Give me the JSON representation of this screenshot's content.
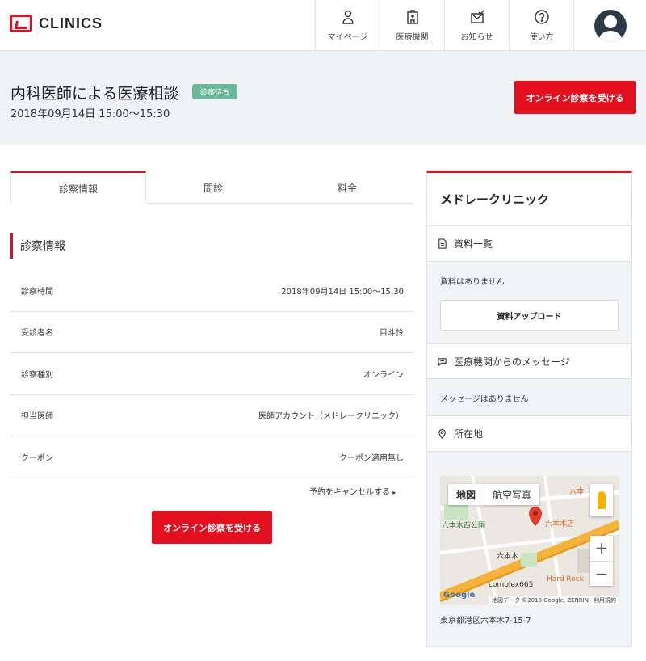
{
  "brand": {
    "name": "CLINICS"
  },
  "nav": {
    "items": [
      {
        "label": "マイページ",
        "icon": "mypage-icon"
      },
      {
        "label": "医療機関",
        "icon": "hospital-icon"
      },
      {
        "label": "お知らせ",
        "icon": "notice-icon"
      },
      {
        "label": "使い方",
        "icon": "help-icon"
      }
    ]
  },
  "header": {
    "title": "内科医師による医療相談",
    "status": "診察待ち",
    "datetime": "2018年09月14日 15:00〜15:30",
    "cta": "オンライン診察を受ける"
  },
  "tabs": [
    {
      "label": "診察情報",
      "active": true
    },
    {
      "label": "問診",
      "active": false
    },
    {
      "label": "料金",
      "active": false
    }
  ],
  "section": {
    "title": "診察情報"
  },
  "details": [
    {
      "label": "診察時間",
      "value": "2018年09月14日 15:00〜15:30"
    },
    {
      "label": "受診者名",
      "value": "目斗怜"
    },
    {
      "label": "診察種別",
      "value": "オンライン"
    },
    {
      "label": "担当医師",
      "value": "医師アカウント（メドレークリニック）"
    },
    {
      "label": "クーポン",
      "value": "クーポン適用無し"
    }
  ],
  "cancel_link": "予約をキャンセルする",
  "main_cta": "オンライン診察を受ける",
  "panel": {
    "clinic_name": "メドレークリニック",
    "documents": {
      "title": "資料一覧",
      "empty": "資料はありません",
      "upload": "資料アップロード"
    },
    "messages": {
      "title": "医療機関からのメッセージ",
      "empty": "メッセージはありません"
    },
    "location": {
      "title": "所在地",
      "address": "東京都港区六本木7-15-7",
      "map": {
        "tab_map": "地図",
        "tab_satellite": "航空写真",
        "zoom_in": "+",
        "zoom_out": "−",
        "labels": {
          "park": "六本木西公園",
          "station": "六本木",
          "shop": "六本木店",
          "complex": "complex665",
          "hardrock": "Hard Rock",
          "roppongi_top": "六本"
        },
        "credit": "地図データ ©2018 Google, ZENRIN",
        "terms": "利用規約",
        "google": "Google"
      }
    }
  },
  "colors": {
    "accent": "#e2101f",
    "status": "#69b89a"
  }
}
